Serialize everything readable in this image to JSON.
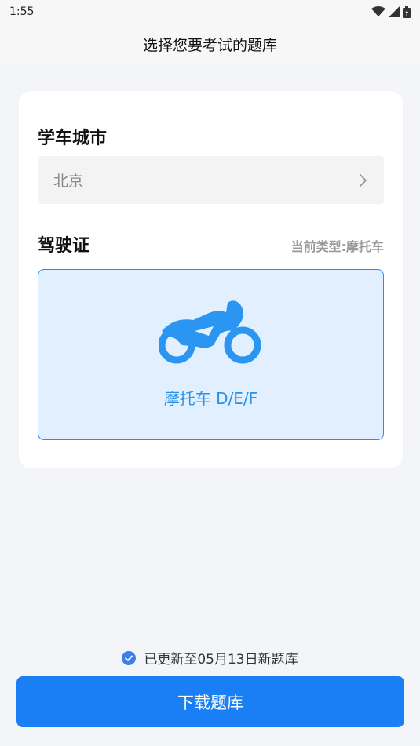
{
  "status_bar": {
    "time": "1:55",
    "icons": [
      "wifi-icon",
      "signal-icon",
      "battery-icon"
    ]
  },
  "header": {
    "title": "选择您要考试的题库"
  },
  "city_section": {
    "title": "学车城市",
    "selected_city": "北京",
    "chevron_icon": "chevron-right-icon"
  },
  "license_section": {
    "title": "驾驶证",
    "current_type": "当前类型:摩托车",
    "option": {
      "icon": "motorcycle-icon",
      "label": "摩托车 D/E/F",
      "selected": true
    }
  },
  "footer": {
    "update_text": "已更新至05月13日新题库",
    "download_label": "下载题库"
  },
  "colors": {
    "accent": "#1a7ef5",
    "selected_bg": "#e1efff",
    "icon_blue": "#2a96f2",
    "page_bg": "#f3f5f8"
  }
}
